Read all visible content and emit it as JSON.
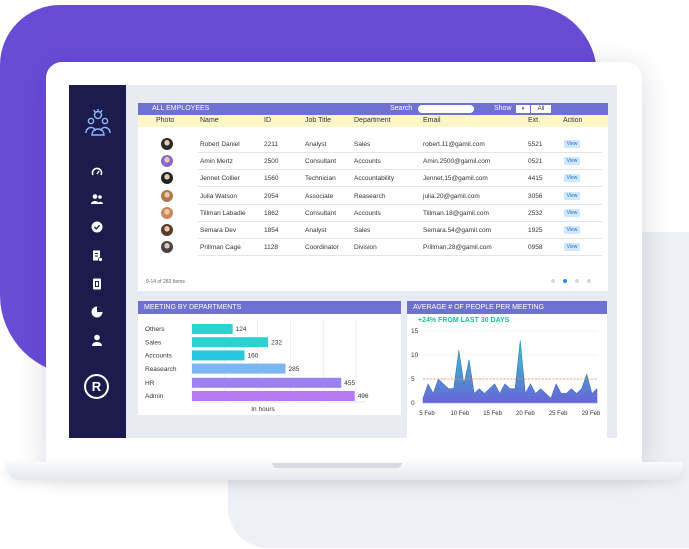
{
  "employees": {
    "title": "ALL EMPLOYEES",
    "search_label": "Search",
    "search_placeholder": "",
    "show_label": "Show",
    "show_toggle": "▾",
    "show_value": "All",
    "columns": [
      "Photo",
      "Name",
      "ID",
      "Job Title",
      "Department",
      "Email",
      "Ext.",
      "Action"
    ],
    "rows": [
      {
        "name": "Robert Daniel",
        "id": "2211",
        "job": "Analyst",
        "dept": "Sales",
        "email": "robert.11@gamil.com",
        "ext": "5521",
        "action": "View",
        "photo_color": "#2a2a2a"
      },
      {
        "name": "Amin Mertz",
        "id": "2500",
        "job": "Consultant",
        "dept": "Accounts",
        "email": "Amin.2500@gamil.com",
        "ext": "0521",
        "action": "View",
        "photo_color": "#8a6ad0"
      },
      {
        "name": "Jennet Collier",
        "id": "1560",
        "job": "Technician",
        "dept": "Accountability",
        "email": "Jennet.15@gamil.com",
        "ext": "4415",
        "action": "View",
        "photo_color": "#222222"
      },
      {
        "name": "Julia Watson",
        "id": "2054",
        "job": "Associate",
        "dept": "Reasearch",
        "email": "julia.20@gamil.com",
        "ext": "3056",
        "action": "View",
        "photo_color": "#b07a4a"
      },
      {
        "name": "Tillman Labadie",
        "id": "1862",
        "job": "Consultant",
        "dept": "Accounts",
        "email": "Tillman.18@gamil.com",
        "ext": "2532",
        "action": "View",
        "photo_color": "#c98a5a"
      },
      {
        "name": "Semara Dev",
        "id": "1854",
        "job": "Analyst",
        "dept": "Sales",
        "email": "Semara.54@gamil.com",
        "ext": "1925",
        "action": "View",
        "photo_color": "#5a3a2a"
      },
      {
        "name": "Prillman Cage",
        "id": "1128",
        "job": "Coordinator",
        "dept": "Division",
        "email": "Prillman.28@gamil.com",
        "ext": "0958",
        "action": "View",
        "photo_color": "#444444"
      }
    ],
    "footer": "9-14 of 283 Items"
  },
  "sidebar": {
    "icons": [
      "dashboard-gauge-icon",
      "users-icon",
      "check-circle-icon",
      "document-icon",
      "contacts-book-icon",
      "pie-chart-icon",
      "user-icon"
    ],
    "badge": "R"
  },
  "chart_data": [
    {
      "type": "bar",
      "title": "MEETING BY DEPARTMENTS",
      "xlabel": "In hours",
      "categories": [
        "Others",
        "Sales",
        "Accounts",
        "Reasearch",
        "HR",
        "Admin"
      ],
      "values": [
        124,
        232,
        160,
        285,
        455,
        496
      ],
      "colors": [
        "#29d3d0",
        "#29d3d0",
        "#29c6e0",
        "#7ab6f0",
        "#9b82f0",
        "#b77af2"
      ],
      "xlim": [
        0,
        500
      ]
    },
    {
      "type": "area",
      "title": "AVERAGE # OF PEOPLE PER MEETING",
      "subtitle": "+24% FROM LAST 30 DAYS",
      "x_ticks": [
        "5 Feb",
        "10 Feb",
        "15 Feb",
        "20 Feb",
        "25 Feb",
        "29 Feb"
      ],
      "y_ticks": [
        0,
        5,
        10,
        15
      ],
      "ylim": [
        0,
        15
      ],
      "reference_line": 5,
      "values": [
        1,
        4,
        2,
        5,
        4,
        3,
        3,
        11,
        4,
        9,
        2,
        3,
        2,
        3,
        4,
        2,
        4,
        3,
        3,
        13,
        2,
        4,
        2,
        3,
        2,
        1,
        4,
        2,
        2,
        3,
        2,
        3,
        6,
        2,
        3
      ],
      "colors": [
        "#2ad0c8",
        "#6a64d8"
      ]
    }
  ]
}
